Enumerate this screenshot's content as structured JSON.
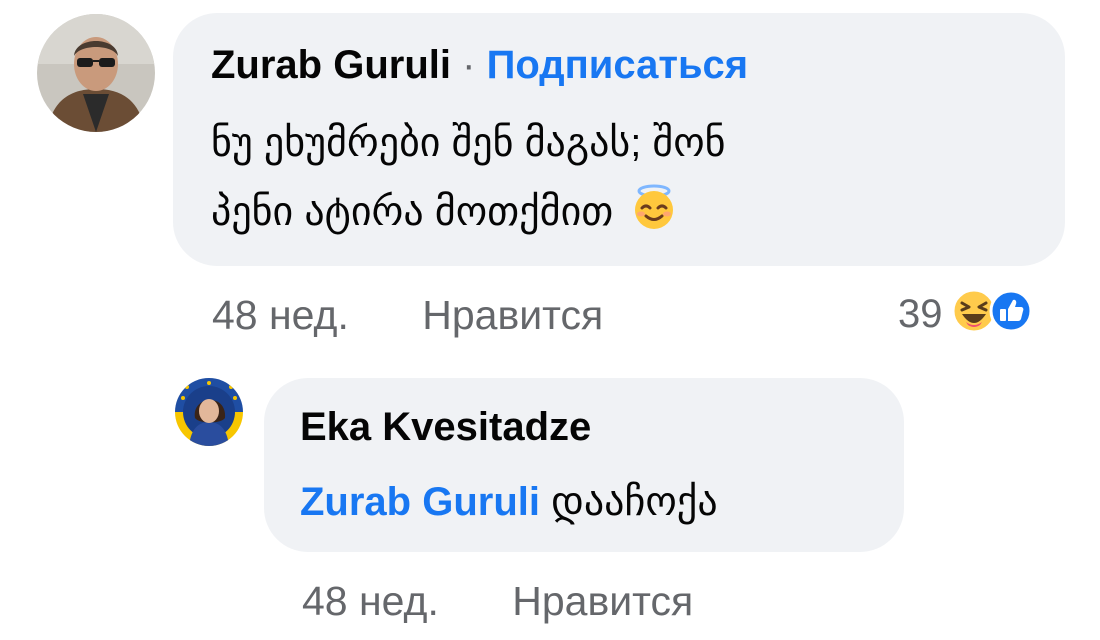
{
  "comments": [
    {
      "author": "Zurab Guruli",
      "separator": "·",
      "follow_label": "Подписаться",
      "text_line1": "ნუ ეხუმრები შენ მაგას; შონ",
      "text_line2": "პენი ატირა მოთქმით",
      "emoji": "smiling-face-with-halo",
      "time": "48 нед.",
      "like_label": "Нравится",
      "reaction_count": "39",
      "reactions": [
        "haha-icon",
        "like-icon"
      ]
    }
  ],
  "reply": {
    "author": "Eka Kvesitadze",
    "mention": "Zurab Guruli",
    "text": "დააჩოქა",
    "time": "48 нед.",
    "like_label": "Нравится"
  },
  "colors": {
    "link": "#1877f2",
    "bubble": "#f0f2f5",
    "secondary_text": "#65676b"
  }
}
